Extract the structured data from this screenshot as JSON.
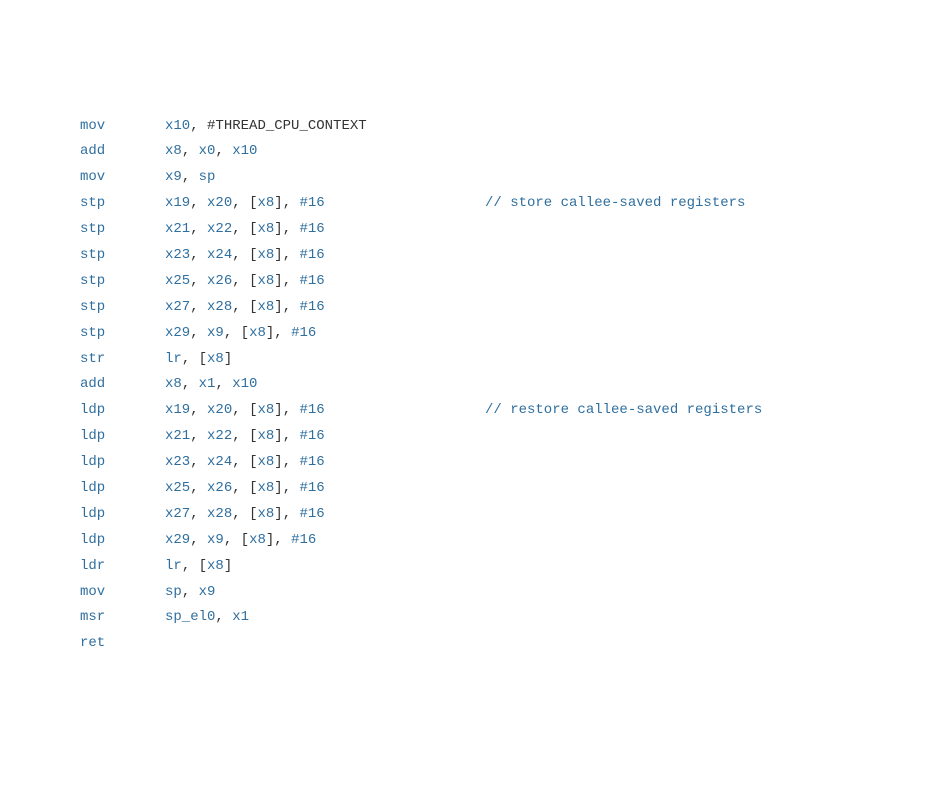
{
  "lines": [
    {
      "mnemonic": "mov",
      "operands_html": "<span class='reg'>x10</span><span class='punc'>, </span><span class='def'>#THREAD_CPU_CONTEXT</span>",
      "comment": ""
    },
    {
      "mnemonic": "add",
      "operands_html": "<span class='reg'>x8</span><span class='punc'>, </span><span class='reg'>x0</span><span class='punc'>, </span><span class='reg'>x10</span>",
      "comment": ""
    },
    {
      "mnemonic": "mov",
      "operands_html": "<span class='reg'>x9</span><span class='punc'>, </span><span class='reg'>sp</span>",
      "comment": ""
    },
    {
      "mnemonic": "stp",
      "operands_html": "<span class='reg'>x19</span><span class='punc'>, </span><span class='reg'>x20</span><span class='punc'>, </span><span class='br'>[</span><span class='reg'>x8</span><span class='br'>]</span><span class='punc'>, </span><span class='imm'>#16</span>",
      "comment": "// store callee-saved registers"
    },
    {
      "mnemonic": "stp",
      "operands_html": "<span class='reg'>x21</span><span class='punc'>, </span><span class='reg'>x22</span><span class='punc'>, </span><span class='br'>[</span><span class='reg'>x8</span><span class='br'>]</span><span class='punc'>, </span><span class='imm'>#16</span>",
      "comment": ""
    },
    {
      "mnemonic": "stp",
      "operands_html": "<span class='reg'>x23</span><span class='punc'>, </span><span class='reg'>x24</span><span class='punc'>, </span><span class='br'>[</span><span class='reg'>x8</span><span class='br'>]</span><span class='punc'>, </span><span class='imm'>#16</span>",
      "comment": ""
    },
    {
      "mnemonic": "stp",
      "operands_html": "<span class='reg'>x25</span><span class='punc'>, </span><span class='reg'>x26</span><span class='punc'>, </span><span class='br'>[</span><span class='reg'>x8</span><span class='br'>]</span><span class='punc'>, </span><span class='imm'>#16</span>",
      "comment": ""
    },
    {
      "mnemonic": "stp",
      "operands_html": "<span class='reg'>x27</span><span class='punc'>, </span><span class='reg'>x28</span><span class='punc'>, </span><span class='br'>[</span><span class='reg'>x8</span><span class='br'>]</span><span class='punc'>, </span><span class='imm'>#16</span>",
      "comment": ""
    },
    {
      "mnemonic": "stp",
      "operands_html": "<span class='reg'>x29</span><span class='punc'>, </span><span class='reg'>x9</span><span class='punc'>, </span><span class='br'>[</span><span class='reg'>x8</span><span class='br'>]</span><span class='punc'>, </span><span class='imm'>#16</span>",
      "comment": ""
    },
    {
      "mnemonic": "str",
      "operands_html": "<span class='reg'>lr</span><span class='punc'>, </span><span class='br'>[</span><span class='reg'>x8</span><span class='br'>]</span>",
      "comment": ""
    },
    {
      "mnemonic": "add",
      "operands_html": "<span class='reg'>x8</span><span class='punc'>, </span><span class='reg'>x1</span><span class='punc'>, </span><span class='reg'>x10</span>",
      "comment": ""
    },
    {
      "mnemonic": "ldp",
      "operands_html": "<span class='reg'>x19</span><span class='punc'>, </span><span class='reg'>x20</span><span class='punc'>, </span><span class='br'>[</span><span class='reg'>x8</span><span class='br'>]</span><span class='punc'>, </span><span class='imm'>#16</span>",
      "comment": "// restore callee-saved registers"
    },
    {
      "mnemonic": "ldp",
      "operands_html": "<span class='reg'>x21</span><span class='punc'>, </span><span class='reg'>x22</span><span class='punc'>, </span><span class='br'>[</span><span class='reg'>x8</span><span class='br'>]</span><span class='punc'>, </span><span class='imm'>#16</span>",
      "comment": ""
    },
    {
      "mnemonic": "ldp",
      "operands_html": "<span class='reg'>x23</span><span class='punc'>, </span><span class='reg'>x24</span><span class='punc'>, </span><span class='br'>[</span><span class='reg'>x8</span><span class='br'>]</span><span class='punc'>, </span><span class='imm'>#16</span>",
      "comment": ""
    },
    {
      "mnemonic": "ldp",
      "operands_html": "<span class='reg'>x25</span><span class='punc'>, </span><span class='reg'>x26</span><span class='punc'>, </span><span class='br'>[</span><span class='reg'>x8</span><span class='br'>]</span><span class='punc'>, </span><span class='imm'>#16</span>",
      "comment": ""
    },
    {
      "mnemonic": "ldp",
      "operands_html": "<span class='reg'>x27</span><span class='punc'>, </span><span class='reg'>x28</span><span class='punc'>, </span><span class='br'>[</span><span class='reg'>x8</span><span class='br'>]</span><span class='punc'>, </span><span class='imm'>#16</span>",
      "comment": ""
    },
    {
      "mnemonic": "ldp",
      "operands_html": "<span class='reg'>x29</span><span class='punc'>, </span><span class='reg'>x9</span><span class='punc'>, </span><span class='br'>[</span><span class='reg'>x8</span><span class='br'>]</span><span class='punc'>, </span><span class='imm'>#16</span>",
      "comment": ""
    },
    {
      "mnemonic": "ldr",
      "operands_html": "<span class='reg'>lr</span><span class='punc'>, </span><span class='br'>[</span><span class='reg'>x8</span><span class='br'>]</span>",
      "comment": ""
    },
    {
      "mnemonic": "mov",
      "operands_html": "<span class='reg'>sp</span><span class='punc'>, </span><span class='reg'>x9</span>",
      "comment": ""
    },
    {
      "mnemonic": "msr",
      "operands_html": "<span class='reg'>sp_el0</span><span class='punc'>, </span><span class='reg'>x1</span>",
      "comment": ""
    },
    {
      "mnemonic": "ret",
      "operands_html": "",
      "comment": ""
    }
  ]
}
